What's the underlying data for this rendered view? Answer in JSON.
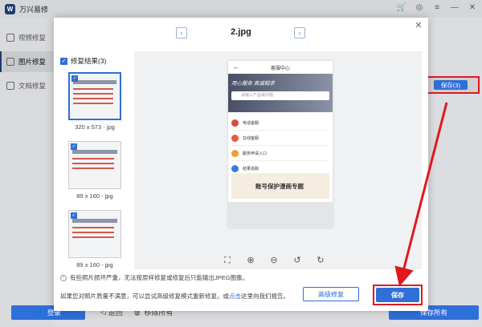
{
  "app": {
    "title": "万兴易修"
  },
  "sidebar": {
    "items": [
      {
        "label": "视频修复"
      },
      {
        "label": "图片修复"
      },
      {
        "label": "文档修复"
      }
    ],
    "login": "登录"
  },
  "bottom": {
    "back": "返回",
    "remove_all": "移除所有",
    "save_all": "保存所有"
  },
  "background_save": "保存(3)",
  "dialog": {
    "file_name": "2.jpg",
    "results_label": "修复结果(3)",
    "thumbnails": [
      {
        "label": "320 x 573 - jpg"
      },
      {
        "label": "89 x 160 - jpg"
      },
      {
        "label": "89 x 160 - jpg"
      }
    ],
    "preview": {
      "header": "客服中心",
      "banner_text": "用心服务 真诚相求",
      "search_placeholder": "请输入产品或问题",
      "items": [
        "电话客服",
        "在线客服",
        "服务申请入口",
        "结果追踪"
      ],
      "promo": "账号保护漫画专题"
    },
    "notice": "有些照片损坏严重，无法按原样修复或修复后只能输出JPEG图像。",
    "advice_prefix": "如果您对照片质量不满意，可以尝试高级修复模式重新修复。或",
    "advice_link": "点击",
    "advice_suffix": "这里向我们报告。",
    "advanced_repair": "高级修复",
    "save": "保存"
  },
  "colors": {
    "accent": "#2f6fd8",
    "highlight": "#e0191f"
  }
}
